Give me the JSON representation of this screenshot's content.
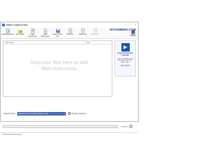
{
  "window": {
    "title": "PRINT CONDUCTOR"
  },
  "toolbar": {
    "items": [
      {
        "label": "Add Documents",
        "icon": "add-documents-icon",
        "enabled": true
      },
      {
        "label": "Add Folder",
        "icon": "add-folder-icon",
        "enabled": true
      },
      {
        "label": "Save Documents",
        "icon": "save-documents-icon",
        "enabled": true
      },
      {
        "label": "Load Documents",
        "icon": "load-documents-icon",
        "enabled": true
      },
      {
        "label": "Save to Print List",
        "icon": "save-list-icon",
        "enabled": true
      },
      {
        "label": "Print List",
        "icon": "print-list-icon",
        "enabled": true
      },
      {
        "label": "Import List",
        "icon": "import-list-icon",
        "enabled": true
      },
      {
        "label": "Export List",
        "icon": "export-list-icon",
        "enabled": false
      }
    ],
    "brand": "NOVAMBINO.COM",
    "about_label": "About Program"
  },
  "file_list": {
    "columns": [
      "File Name",
      "Type"
    ],
    "drop_hint": "Drop your files here or add them from menu"
  },
  "ad": {
    "title": "universal document converter",
    "text": "gives you ability to print documents into PDF, JPEG, TIFF...",
    "link": "Get it now!"
  },
  "preset": {
    "label": "Select Printer:",
    "value": "Microsoft Print to PDF (Windows 10)",
    "settings_label": "Change Settings"
  },
  "progress": {
    "fraction": 0,
    "start_label": "START"
  },
  "status": {
    "text": "Documents list is empty"
  },
  "colors": {
    "accent": "#1f3a8a",
    "select_bg": "#4a6fc4"
  }
}
